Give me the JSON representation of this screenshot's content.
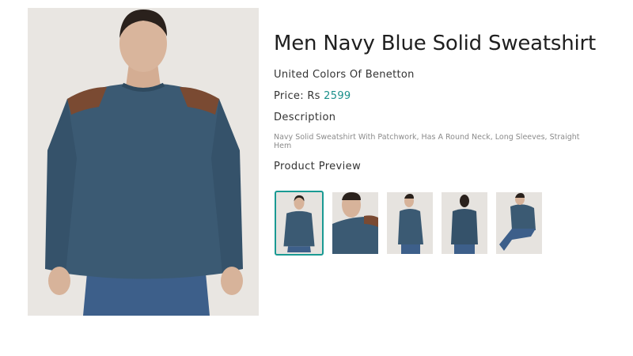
{
  "product": {
    "title": "Men Navy Blue Solid Sweatshirt",
    "brand": "United Colors Of Benetton",
    "price_label": "Price: Rs",
    "price_value": "2599",
    "description_heading": "Description",
    "description_text": "Navy Solid Sweatshirt With Patchwork, Has A Round Neck, Long Sleeves, Straight Hem",
    "preview_heading": "Product Preview"
  },
  "colors": {
    "accent": "#1a9a93",
    "price": "#1a8f8a",
    "sweatshirt": "#3b5a73",
    "patch": "#7a4a32"
  },
  "thumbnails": {
    "count": 5,
    "selected_index": 0,
    "views": [
      "front",
      "shoulder-closeup",
      "side",
      "back",
      "seated"
    ]
  }
}
